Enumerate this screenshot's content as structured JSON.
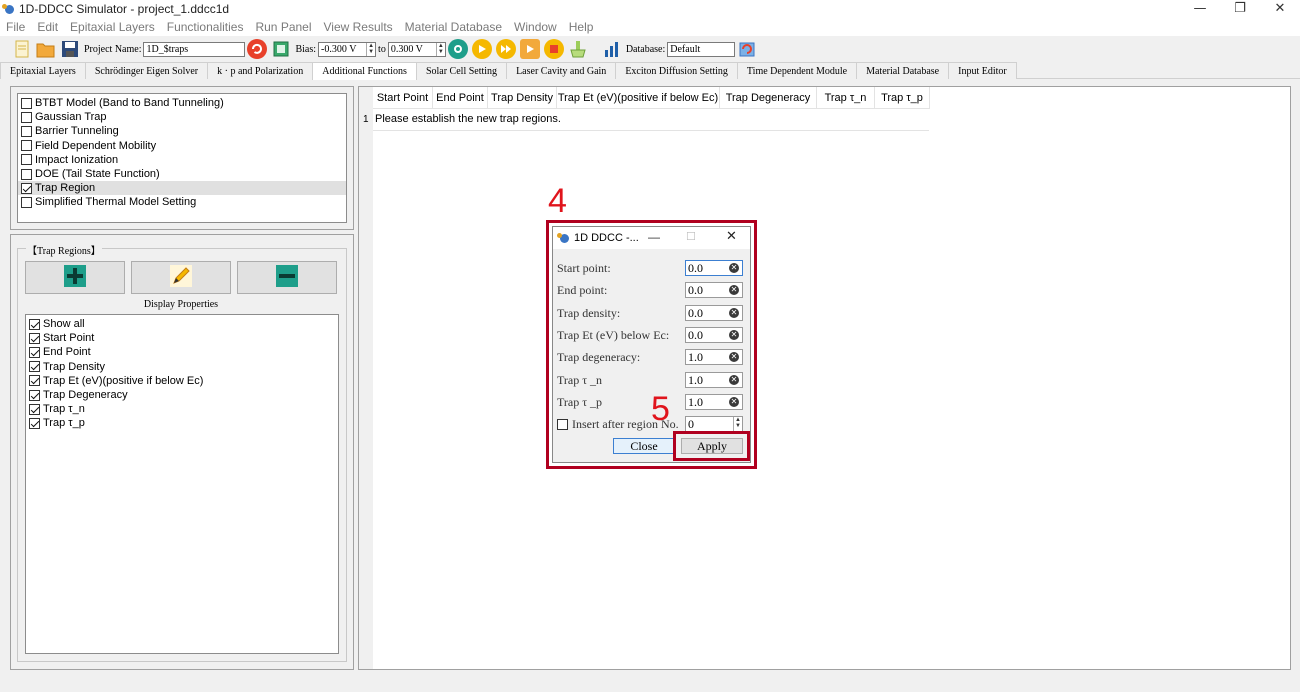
{
  "window": {
    "title": "1D-DDCC Simulator - project_1.ddcc1d",
    "minimize": "—",
    "restore": "❐",
    "close": "✕"
  },
  "menu": [
    "File",
    "Edit",
    "Epitaxial Layers",
    "Functionalities",
    "Run Panel",
    "View Results",
    "Material Database",
    "Window",
    "Help"
  ],
  "toolbar": {
    "project_label": "Project Name:",
    "project_value": "1D_$traps",
    "bias_label": "Bias:",
    "bias_from": "-0.300 V",
    "to_label": "to",
    "bias_to": "0.300 V",
    "database_label": "Database:",
    "database_value": "Default"
  },
  "tabs": [
    "Epitaxial Layers",
    "Schrödinger Eigen Solver",
    "k · p and Polarization",
    "Additional Functions",
    "Solar Cell Setting",
    "Laser Cavity and Gain",
    "Exciton Diffusion Setting",
    "Time Dependent Module",
    "Material Database",
    "Input Editor"
  ],
  "active_tab": "Additional Functions",
  "functions": [
    {
      "label": "BTBT Model (Band to Band Tunneling)",
      "checked": false
    },
    {
      "label": "Gaussian Trap",
      "checked": false
    },
    {
      "label": "Barrier Tunneling",
      "checked": false
    },
    {
      "label": "Field Dependent Mobility",
      "checked": false
    },
    {
      "label": "Impact Ionization",
      "checked": false
    },
    {
      "label": "DOE (Tail State Function)",
      "checked": false
    },
    {
      "label": "Trap Region",
      "checked": true
    },
    {
      "label": "Simplified Thermal Model Setting",
      "checked": false
    }
  ],
  "trap_regions": {
    "title": "【Trap Regions】",
    "display_properties": "Display Properties",
    "properties": [
      {
        "label": "Show all",
        "checked": true
      },
      {
        "label": "Start Point",
        "checked": true
      },
      {
        "label": "End Point",
        "checked": true
      },
      {
        "label": "Trap Density",
        "checked": true
      },
      {
        "label": "Trap Et (eV)(positive if below Ec)",
        "checked": true
      },
      {
        "label": "Trap Degeneracy",
        "checked": true
      },
      {
        "label": "Trap τ_n",
        "checked": true
      },
      {
        "label": "Trap τ_p",
        "checked": true
      }
    ]
  },
  "table": {
    "columns": [
      "Start Point",
      "End Point",
      "Trap Density",
      "Trap Et (eV)(positive if below Ec)",
      "Trap Degeneracy",
      "Trap τ_n",
      "Trap τ_p"
    ],
    "row_number": "1",
    "row_message": "Please establish the new trap regions."
  },
  "dialog": {
    "title": "1D DDCC -...",
    "fields": [
      {
        "label": "Start point:",
        "value": "0.0"
      },
      {
        "label": "End point:",
        "value": "0.0"
      },
      {
        "label": "Trap density:",
        "value": "0.0"
      },
      {
        "label": "Trap Et (eV) below Ec:",
        "value": "0.0"
      },
      {
        "label": "Trap degeneracy:",
        "value": "1.0"
      },
      {
        "label": "Trap  τ _n",
        "value": "1.0"
      },
      {
        "label": "Trap  τ _p",
        "value": "1.0"
      }
    ],
    "insert_label": "Insert after region No.",
    "insert_value": "0",
    "close_label": "Close",
    "apply_label": "Apply"
  },
  "annotations": {
    "step4": "4",
    "step5": "5"
  },
  "colors": {
    "annotation_red": "#b0001f",
    "annotation_text": "#e0141c",
    "accent_teal": "#1e9e8a"
  }
}
